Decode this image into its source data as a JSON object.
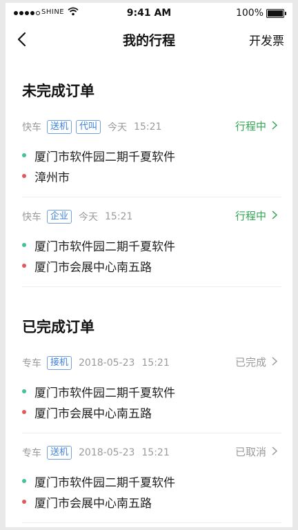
{
  "status_bar": {
    "carrier": "SHINE",
    "time": "9:41 AM",
    "battery": "100%"
  },
  "nav": {
    "title": "我的行程",
    "action": "开发票"
  },
  "sections": {
    "unfinished_title": "未完成订单",
    "finished_title": "已完成订单"
  },
  "orders": [
    {
      "vehicle": "快车",
      "tags": [
        "送机",
        "代叫"
      ],
      "date": "今天",
      "time": "15:21",
      "status": "行程中",
      "from": "厦门市软件园二期千夏软件",
      "to": "漳州市"
    },
    {
      "vehicle": "快车",
      "tags": [
        "企业"
      ],
      "date": "今天",
      "time": "15:21",
      "status": "行程中",
      "from": "厦门市软件园二期千夏软件",
      "to": "厦门市会展中心南五路"
    },
    {
      "vehicle": "专车",
      "tags": [
        "接机"
      ],
      "date": "2018-05-23",
      "time": "15:21",
      "status": "已完成",
      "from": "厦门市软件园二期千夏软件",
      "to": "厦门市会展中心南五路"
    },
    {
      "vehicle": "专车",
      "tags": [
        "送机"
      ],
      "date": "2018-05-23",
      "time": "15:21",
      "status": "已取消",
      "from": "厦门市软件园二期千夏软件",
      "to": "厦门市会展中心南五路"
    }
  ],
  "colors": {
    "active_status": "#31a653",
    "tag_blue": "#3b7fd9",
    "origin_dot": "#43c19a",
    "destination_dot": "#e2585f"
  }
}
